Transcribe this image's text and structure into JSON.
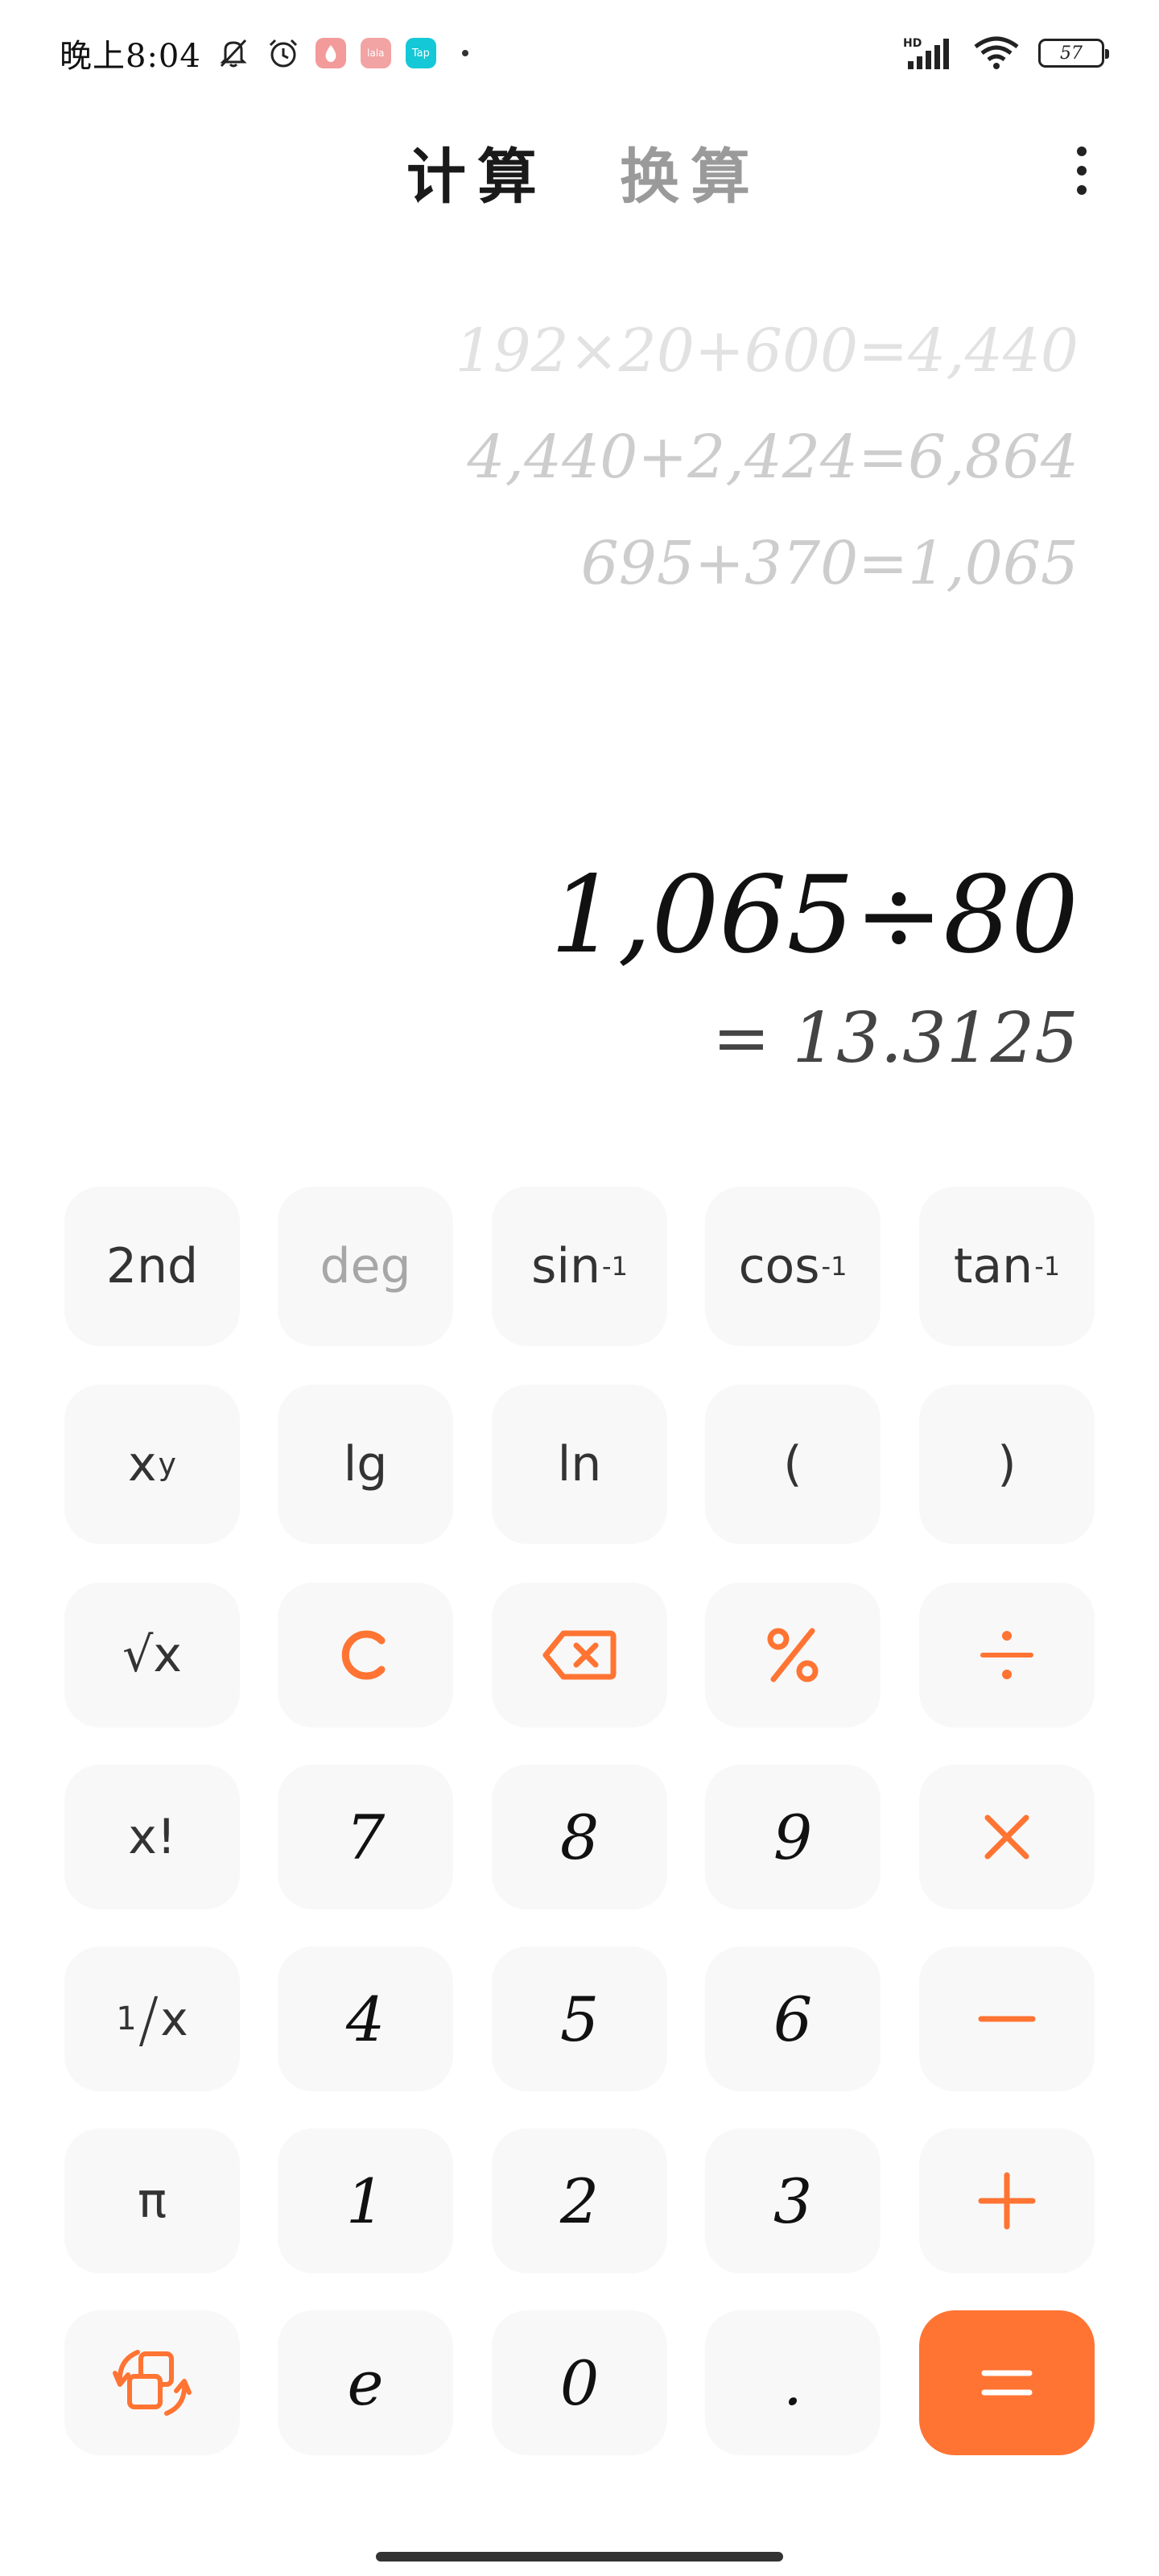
{
  "status_bar": {
    "time": "晚上8:04",
    "icons": [
      "mute-icon",
      "alarm-icon",
      "app-icon-red",
      "app-icon-lala",
      "app-icon-tap"
    ],
    "app_badges": {
      "lala": "lala",
      "tap": "Tap"
    },
    "network": "HD",
    "battery": "57"
  },
  "header": {
    "tabs": [
      {
        "label": "计算",
        "active": true
      },
      {
        "label": "换算",
        "active": false
      }
    ]
  },
  "history": [
    "192×20+600=4,440",
    "4,440+2,424=6,864",
    "695+370=1,065"
  ],
  "expression": "1,065÷80",
  "result": "= 13.3125",
  "keys": {
    "second": "2nd",
    "deg": "deg",
    "asin": "sin",
    "acos": "cos",
    "atan": "tan",
    "inv_sup": "-1",
    "pow_base": "x",
    "pow_exp": "y",
    "lg": "lg",
    "ln": "ln",
    "lparen": "(",
    "rparen": ")",
    "sqrt": "√x",
    "fact": "x!",
    "recip_num": "1",
    "recip_x": "x",
    "pi": "π",
    "e": "e",
    "dot": ".",
    "n0": "0",
    "n1": "1",
    "n2": "2",
    "n3": "3",
    "n4": "4",
    "n5": "5",
    "n6": "6",
    "n7": "7",
    "n8": "8",
    "n9": "9"
  },
  "colors": {
    "accent": "#ff7433",
    "key_bg": "#f8f8f8",
    "text": "#111111",
    "muted": "#a7a7a7"
  }
}
